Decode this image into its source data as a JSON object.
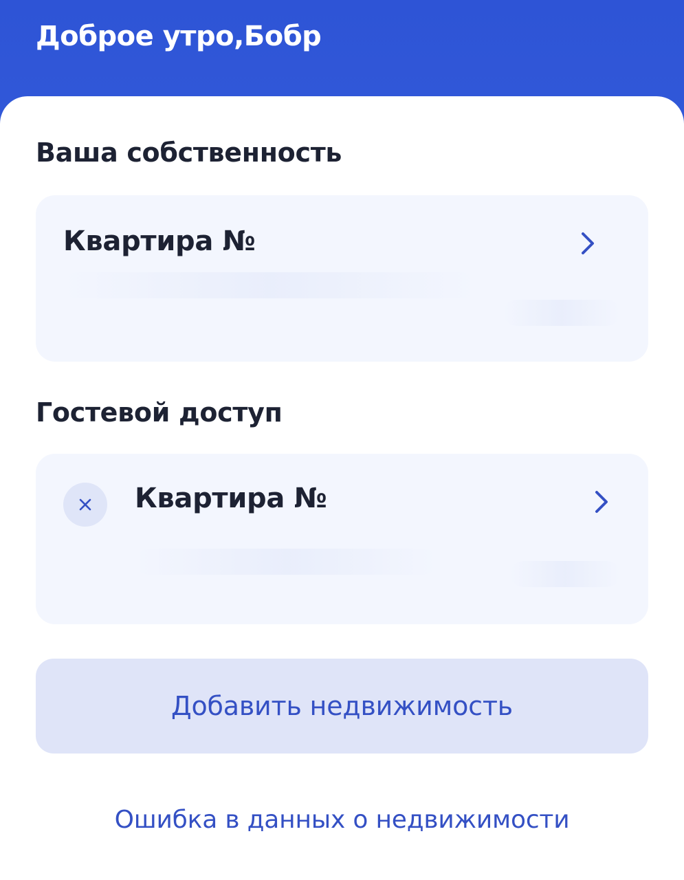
{
  "header": {
    "greeting": "Доброе утро,",
    "user_name": "Бобр"
  },
  "owned": {
    "section_title": "Ваша собственность",
    "items": [
      {
        "title": "Квартира №"
      }
    ]
  },
  "guest": {
    "section_title": "Гостевой доступ",
    "items": [
      {
        "title": "Квартира №"
      }
    ]
  },
  "actions": {
    "add_property_label": "Добавить недвижимость",
    "report_error_label": "Ошибка в данных о недвижимости"
  },
  "colors": {
    "header_bg": "#2f55d4",
    "card_bg": "#f3f6fe",
    "accent": "#3450c4",
    "text": "#1d2233"
  },
  "icons": {
    "chevron": "chevron-right-icon",
    "remove": "close-icon"
  }
}
